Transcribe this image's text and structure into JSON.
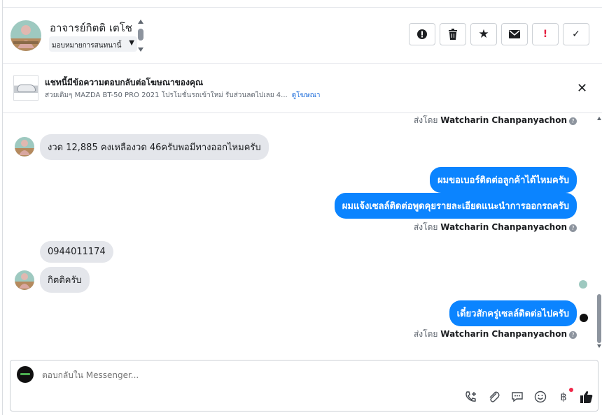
{
  "header": {
    "name": "อาจารย์กิตติ เตโช",
    "assign_label": "มอบหมายการสนทนานี้",
    "actions": [
      {
        "icon": "alert-circle-icon",
        "glyph": "!"
      },
      {
        "icon": "trash-icon",
        "glyph": "🗑"
      },
      {
        "icon": "star-icon",
        "glyph": "★"
      },
      {
        "icon": "envelope-icon",
        "glyph": "✉"
      },
      {
        "icon": "exclamation-icon",
        "glyph": "!"
      },
      {
        "icon": "check-icon",
        "glyph": "✓"
      }
    ]
  },
  "ad": {
    "title": "แชทนี้มีข้อความตอบกลับต่อโฆษณาของคุณ",
    "subtitle": "สวยเดิมๆ MAZDA BT-50 PRO 2021 โปรโมชั่นรถเข้าใหม่ รับส่วนลดไปเลย 4...",
    "link": "ดูโฆษณา",
    "close_glyph": "✕"
  },
  "messages": {
    "sent_by_prefix": "ส่งโดย",
    "sender": "Watcharin Chanpanyachon",
    "info_glyph": "?",
    "in_1": "งวด 12,885 คงเหลืองวด 46ครับพอมีทางออกไหมครับ",
    "out_1": "ผมขอเบอร์ติดต่อลูกค้าได้ไหมครับ",
    "out_2": "ผมแจ้งเซลล์ติดต่อพูดคุยรายละเอียดแนะนำการออกรถครับ",
    "in_2": "0944011174",
    "in_3": "กิตติครับ",
    "out_3": "เดี๋ยวสักครู่เซลล์ติดต่อไปครับ"
  },
  "composer": {
    "placeholder": "ตอบกลับใน Messenger...",
    "tools": [
      {
        "icon": "phone-add-icon",
        "glyph": "☏"
      },
      {
        "icon": "paperclip-icon",
        "glyph": "📎"
      },
      {
        "icon": "saved-reply-icon",
        "glyph": "💬"
      },
      {
        "icon": "emoji-icon",
        "glyph": "☺"
      },
      {
        "icon": "baht-payment-icon",
        "glyph": "฿"
      },
      {
        "icon": "thumbs-up-icon",
        "glyph": "👍"
      }
    ]
  },
  "colors": {
    "accent": "#0b84ff",
    "incoming_bubble": "#e4e6eb",
    "link": "#216fdb"
  }
}
